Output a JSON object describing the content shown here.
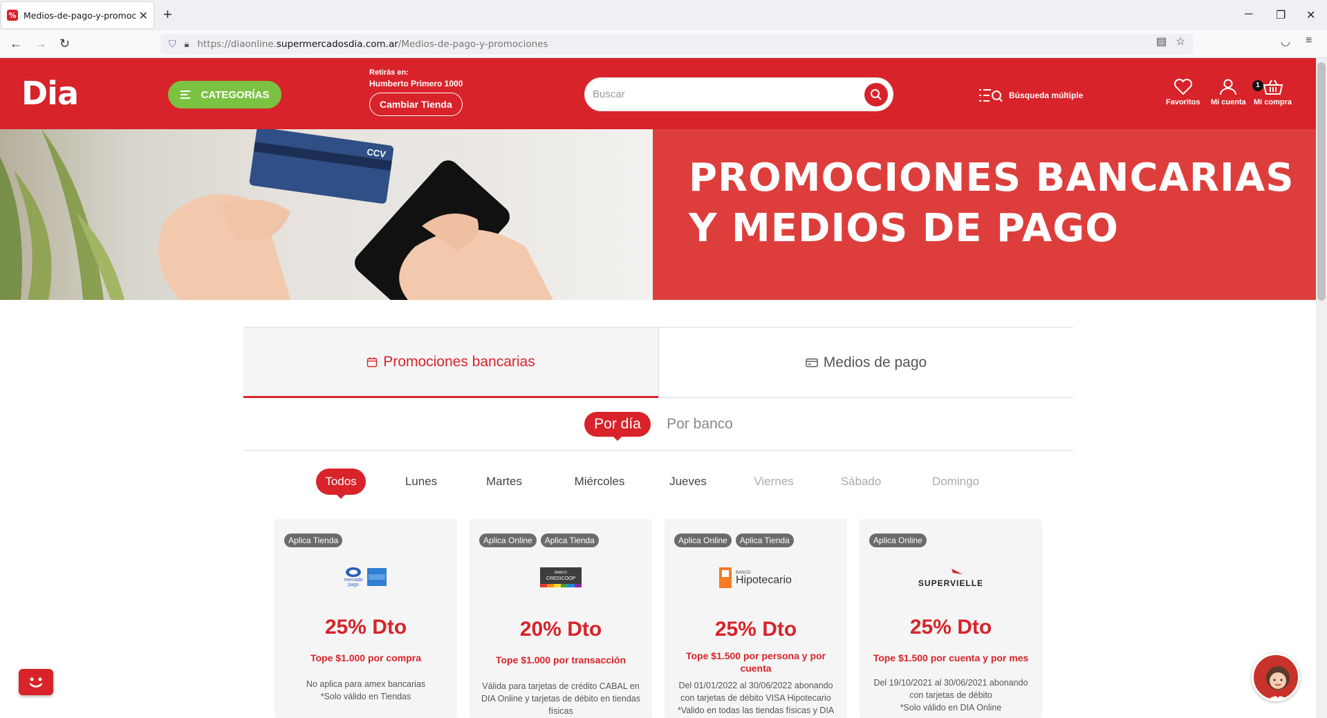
{
  "browser": {
    "tab_title": "Medios-de-pago-y-promociones",
    "url_prefix": "https://diaonline.",
    "url_domain": "supermercadosdia.com.ar",
    "url_path": "/Medios-de-pago-y-promociones"
  },
  "header": {
    "logo_text": "Dia",
    "categories_label": "CATEGORÍAS",
    "store_prefix": "Retirás en:",
    "store_name": "Humberto Primero 1000",
    "change_store_label": "Cambiar Tienda",
    "search_placeholder": "Buscar",
    "multi_search_label": "Búsqueda múltiple",
    "favorites_label": "Favoritos",
    "account_label": "Mi cuenta",
    "cart_label": "Mi compra",
    "cart_count": "1"
  },
  "banner": {
    "line1": "PROMOCIONES BANCARIAS",
    "line2": "Y MEDIOS DE PAGO",
    "card_text": "CCV"
  },
  "main_tabs": {
    "promos": "Promociones bancarias",
    "payments": "Medios de pago"
  },
  "sub_tabs": {
    "by_day": "Por día",
    "by_bank": "Por banco"
  },
  "days": [
    "Todos",
    "Lunes",
    "Martes",
    "Miércoles",
    "Jueves",
    "Viernes",
    "Sábado",
    "Domingo"
  ],
  "cards": [
    {
      "badges": [
        "Aplica Tienda"
      ],
      "discount": "25% Dto",
      "tope": "Tope $1.000 por compra",
      "conditions": [
        "No aplica para amex bancarias",
        "*Solo válido en Tiendas"
      ]
    },
    {
      "badges": [
        "Aplica Online",
        "Aplica Tienda"
      ],
      "discount": "20% Dto",
      "tope": "Tope $1.000 por transacción",
      "conditions": [
        "Válida para tarjetas de crédito CABAL en DIA Online y tarjetas de débito en tiendas físicas"
      ]
    },
    {
      "badges": [
        "Aplica Online",
        "Aplica Tienda"
      ],
      "discount": "25% Dto",
      "tope": "Tope $1.500 por persona y por cuenta",
      "conditions": [
        "Del 01/01/2022 al 30/06/2022 abonando con tarjetas de débito VISA Hipotecario",
        "*Valido en todas las tiendas físicas y DIA"
      ]
    },
    {
      "badges": [
        "Aplica Online"
      ],
      "discount": "25% Dto",
      "tope": "Tope $1.500 por cuenta y por mes",
      "conditions": [
        "Del 19/10/2021 al 30/06/2021 abonando con tarjetas de débito",
        "*Solo válido en DIA Online"
      ]
    }
  ],
  "bank_logos": {
    "mercadopago_top": "mercado",
    "mercadopago_bottom": "pago",
    "credicoop_top": "BANCO",
    "credicoop_main": "CREDICOOP",
    "hipotecario_top": "BANCO",
    "hipotecario_main": "Hipotecario",
    "supervielle": "SUPERVIELLE"
  },
  "colors": {
    "brand_red": "#d8232a",
    "green": "#7cc242",
    "badge_gray": "#6b6b6b"
  }
}
